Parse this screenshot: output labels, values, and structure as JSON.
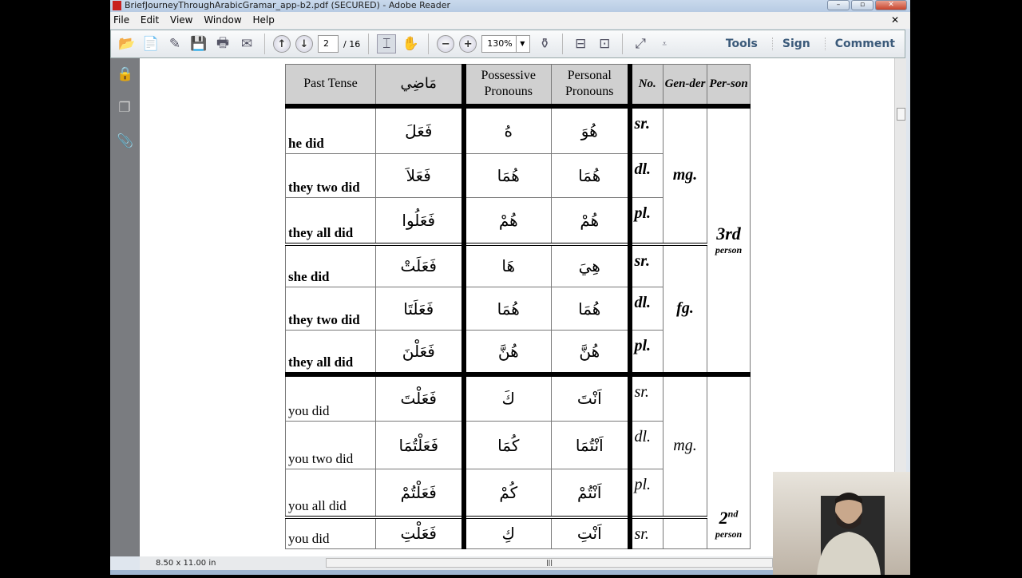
{
  "window": {
    "title": "BriefJourneyThroughArabicGramar_app-b2.pdf (SECURED) - Adobe Reader"
  },
  "menu": [
    "File",
    "Edit",
    "View",
    "Window",
    "Help"
  ],
  "toolbar": {
    "page_current": "2",
    "page_total": "/ 16",
    "zoom": "130%",
    "tools": "Tools",
    "sign": "Sign",
    "comment": "Comment"
  },
  "status": {
    "page_size": "8.50 x 11.00 in"
  },
  "table": {
    "headers": [
      "Past  Tense",
      "مَاضِي",
      "Possessive Pronouns",
      "Personal Pronouns",
      "No.",
      "Gen-der",
      "Per-son"
    ],
    "groups": [
      {
        "gender": "mg.",
        "rows": [
          {
            "en": "he did",
            "past": "فَعَلَ",
            "poss": "هُ",
            "pers": "هُوَ",
            "no": "sr."
          },
          {
            "en": "they two did",
            "past": "فَعَلاَ",
            "poss": "هُمَا",
            "pers": "هُمَا",
            "no": "dl."
          },
          {
            "en": "they all did",
            "past": "فَعَلُوا",
            "poss": "هُمْ",
            "pers": "هُمْ",
            "no": "pl."
          }
        ]
      },
      {
        "gender": "fg.",
        "rows": [
          {
            "en": "she did",
            "past": "فَعَلَتْ",
            "poss": "هَا",
            "pers": "هِيَ",
            "no": "sr."
          },
          {
            "en": "they two did",
            "past": "فَعَلَتَا",
            "poss": "هُمَا",
            "pers": "هُمَا",
            "no": "dl."
          },
          {
            "en": "they all did",
            "past": "فَعَلْنَ",
            "poss": "هُنَّ",
            "pers": "هُنَّ",
            "no": "pl."
          }
        ]
      },
      {
        "gender": "mg.",
        "rows": [
          {
            "en": "you did",
            "past": "فَعَلْتَ",
            "poss": "كَ",
            "pers": "اَنْتَ",
            "no": "sr."
          },
          {
            "en": "you two did",
            "past": "فَعَلْتُمَا",
            "poss": "كُمَا",
            "pers": "اَنْتُمَا",
            "no": "dl."
          },
          {
            "en": "you all did",
            "past": "فَعَلْتُمْ",
            "poss": "كُمْ",
            "pers": "اَنْتُمْ",
            "no": "pl."
          }
        ]
      },
      {
        "gender": "",
        "rows": [
          {
            "en": "you did",
            "past": "فَعَلْتِ",
            "poss": "كِ",
            "pers": "اَنْتِ",
            "no": "sr."
          }
        ]
      }
    ],
    "person3": {
      "main": "3rd",
      "sub": "person"
    },
    "person2": {
      "main": "2",
      "sup": "nd",
      "sub": "person"
    }
  }
}
